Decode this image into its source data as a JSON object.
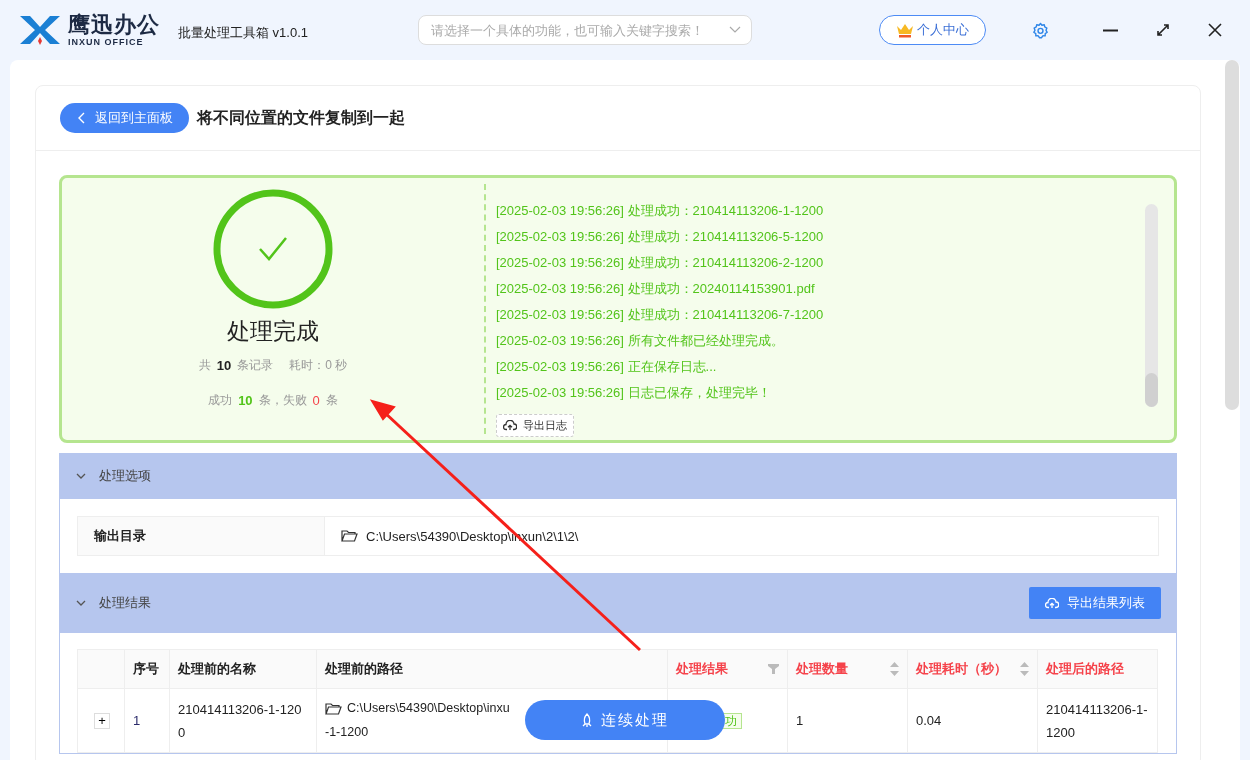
{
  "app": {
    "brand": "鹰迅办公",
    "brand_sub": "INXUN OFFICE",
    "title": "批量处理工具箱 v1.0.1"
  },
  "search": {
    "placeholder": "请选择一个具体的功能，也可输入关键字搜索！"
  },
  "user_button": "个人中心",
  "back_button": "返回到主面板",
  "page_title": "将不同位置的文件复制到一起",
  "result": {
    "title": "处理完成",
    "total_prefix": "共",
    "total": "10",
    "total_suffix": "条记录",
    "time": "耗时：0 秒",
    "success_label": "成功",
    "success": "10",
    "mid": "条，失败",
    "failed": "0",
    "end": "条"
  },
  "log": [
    "[2025-02-03 19:56:26] 处理成功：210414113206-1-1200",
    "[2025-02-03 19:56:26] 处理成功：210414113206-5-1200",
    "[2025-02-03 19:56:26] 处理成功：210414113206-2-1200",
    "[2025-02-03 19:56:26] 处理成功：20240114153901.pdf",
    "[2025-02-03 19:56:26] 处理成功：210414113206-7-1200",
    "[2025-02-03 19:56:26] 所有文件都已经处理完成。",
    "[2025-02-03 19:56:26] 正在保存日志...",
    "[2025-02-03 19:56:26] 日志已保存，处理完毕！"
  ],
  "export_log_button": "导出日志",
  "options_section": {
    "title": "处理选项",
    "expanded": true,
    "label": "输出目录",
    "value": "C:\\Users\\54390\\Desktop\\inxun\\2\\1\\2\\"
  },
  "results_section": {
    "title": "处理结果",
    "expanded": true,
    "export_button": "导出结果列表"
  },
  "table": {
    "columns": [
      {
        "kind": "plain",
        "highlighted": false
      },
      {
        "label": "序号",
        "kind": "plain",
        "highlighted": false
      },
      {
        "label": "处理前的名称",
        "kind": "plain",
        "highlighted": false
      },
      {
        "label": "处理前的路径",
        "kind": "plain",
        "highlighted": false
      },
      {
        "label": "处理结果",
        "kind": "filter",
        "highlighted": true
      },
      {
        "label": "处理数量",
        "kind": "sort",
        "highlighted": true
      },
      {
        "label": "处理耗时（秒）",
        "kind": "sort",
        "highlighted": true
      },
      {
        "label": "处理后的路径",
        "kind": "plain",
        "highlighted": true
      }
    ],
    "rows": [
      {
        "expand": "+",
        "index": "1",
        "name": "210414113206-1-1200",
        "path_start": "C:\\Users\\54390\\Desktop\\inxu",
        "path_end": "-1-1200",
        "result": "功",
        "count": "1",
        "time": "0.04",
        "after_path": "210414113206-1-1200"
      }
    ]
  },
  "floating_button": "连续处理"
}
